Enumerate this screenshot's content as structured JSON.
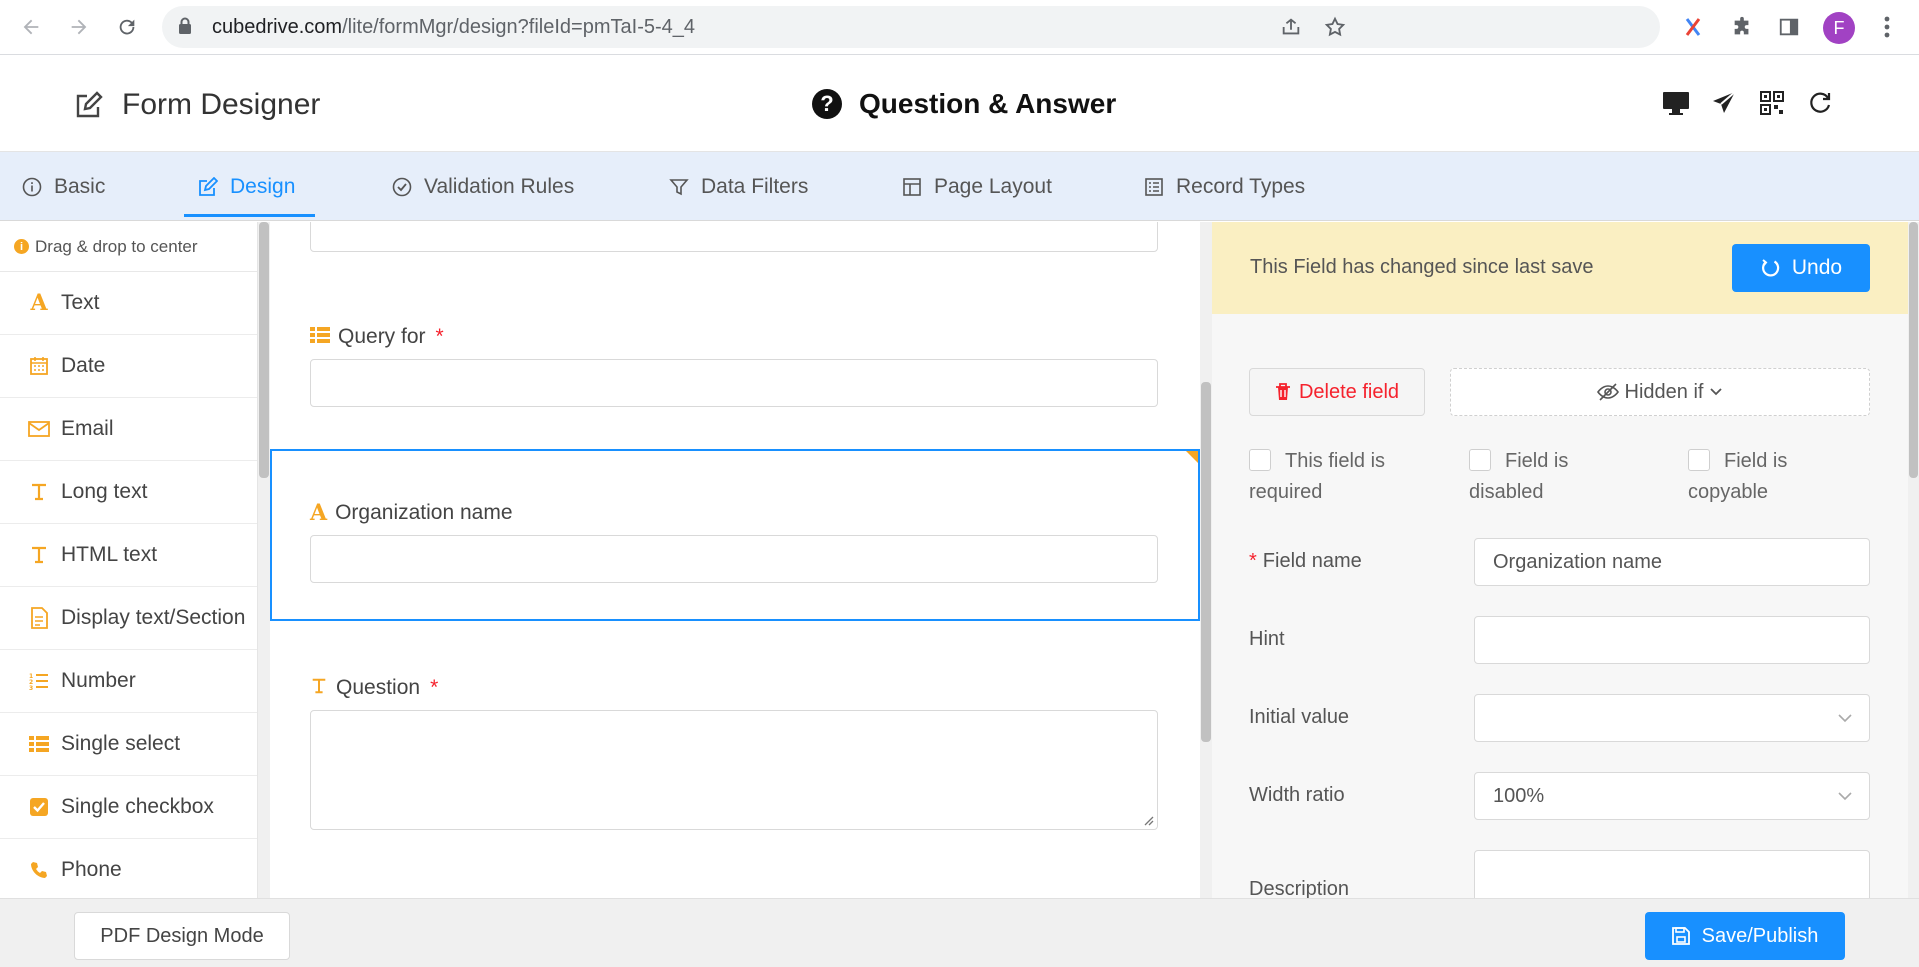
{
  "browser": {
    "url_host": "cubedrive.com",
    "url_path": "/lite/formMgr/design?fileId=pmTaI-5-4_4",
    "profile_initial": "F"
  },
  "header": {
    "app_title": "Form Designer",
    "form_title": "Question & Answer"
  },
  "tabs": [
    {
      "label": "Basic",
      "icon": "info-circle-icon"
    },
    {
      "label": "Design",
      "icon": "edit-icon"
    },
    {
      "label": "Validation Rules",
      "icon": "check-circle-icon"
    },
    {
      "label": "Data Filters",
      "icon": "filter-icon"
    },
    {
      "label": "Page Layout",
      "icon": "layout-icon"
    },
    {
      "label": "Record Types",
      "icon": "list-icon"
    }
  ],
  "palette": {
    "hint": "Drag & drop to center",
    "items": [
      {
        "label": "Text",
        "icon": "text-a-icon"
      },
      {
        "label": "Date",
        "icon": "calendar-icon"
      },
      {
        "label": "Email",
        "icon": "mail-icon"
      },
      {
        "label": "Long text",
        "icon": "long-text-icon"
      },
      {
        "label": "HTML text",
        "icon": "html-text-icon"
      },
      {
        "label": "Display text/Section",
        "icon": "document-icon"
      },
      {
        "label": "Number",
        "icon": "number-list-icon"
      },
      {
        "label": "Single select",
        "icon": "list-icon"
      },
      {
        "label": "Single checkbox",
        "icon": "checkbox-icon"
      },
      {
        "label": "Phone",
        "icon": "phone-icon"
      }
    ]
  },
  "canvas": {
    "fields": [
      {
        "label": "Query for",
        "required": "*"
      },
      {
        "label": "Organization name",
        "required": ""
      },
      {
        "label": "Question",
        "required": "*"
      }
    ]
  },
  "properties": {
    "alert_message": "This Field has changed since last save",
    "undo_label": "Undo",
    "delete_label": "Delete field",
    "hidden_if_label": "Hidden if",
    "checkboxes": [
      {
        "line1": "This field is",
        "line2": "required"
      },
      {
        "line1": "Field is",
        "line2": "disabled"
      },
      {
        "line1": "Field is",
        "line2": "copyable"
      }
    ],
    "field_name_label": "Field name",
    "field_name_required": "*",
    "field_name_value": "Organization name",
    "hint_label": "Hint",
    "hint_value": "",
    "initial_value_label": "Initial value",
    "initial_value": "",
    "width_ratio_label": "Width ratio",
    "width_ratio_value": "100%",
    "description_label": "Description"
  },
  "footer": {
    "pdf_label": "PDF Design Mode",
    "save_label": "Save/Publish"
  },
  "colors": {
    "accent": "#1890ff",
    "field_icon": "#f5a623",
    "required": "#f5222d",
    "alert_bg": "#faefc2"
  }
}
